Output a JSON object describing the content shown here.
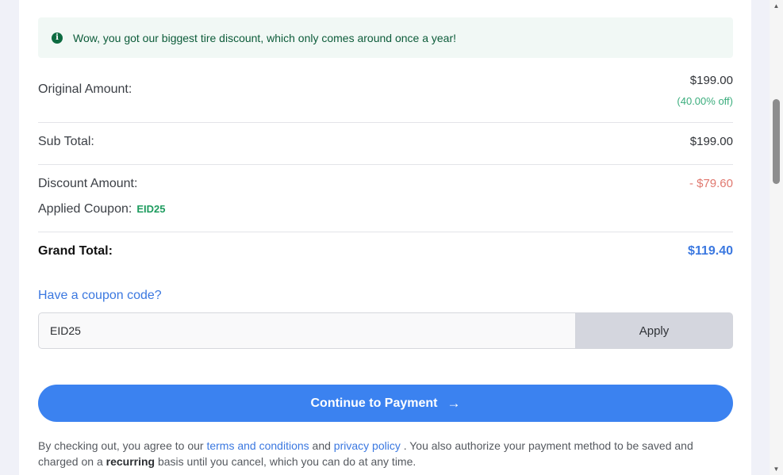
{
  "alert": {
    "icon": "info-circle-icon",
    "text": "Wow, you got our biggest tire discount, which only comes around once a year!"
  },
  "summary": {
    "original_label": "Original Amount:",
    "original_value": "$199.00",
    "original_discount_pct": "(40.00% off)",
    "subtotal_label": "Sub Total:",
    "subtotal_value": "$199.00",
    "discount_label": "Discount Amount:",
    "discount_value": "- $79.60",
    "coupon_label": "Applied Coupon:",
    "coupon_code": "EID25",
    "grand_label": "Grand Total:",
    "grand_value": "$119.40"
  },
  "coupon": {
    "link_text": "Have a coupon code?",
    "input_value": "EID25",
    "apply_label": "Apply"
  },
  "payment": {
    "button_label": "Continue to Payment",
    "arrow_icon": "arrow-right-icon"
  },
  "legal": {
    "prefix": "By checking out, you agree to our",
    "terms_link": "terms and conditions",
    "and": "and",
    "privacy_link": "privacy policy",
    "middle": ". You also authorize your payment method to be saved and charged on a",
    "recurring": "recurring",
    "suffix": "basis until you cancel, which you can do at any time."
  },
  "colors": {
    "accent": "#3b82f0",
    "success": "#1e9c5f",
    "discount": "#e0786f",
    "alert_bg": "#f1f8f5"
  }
}
